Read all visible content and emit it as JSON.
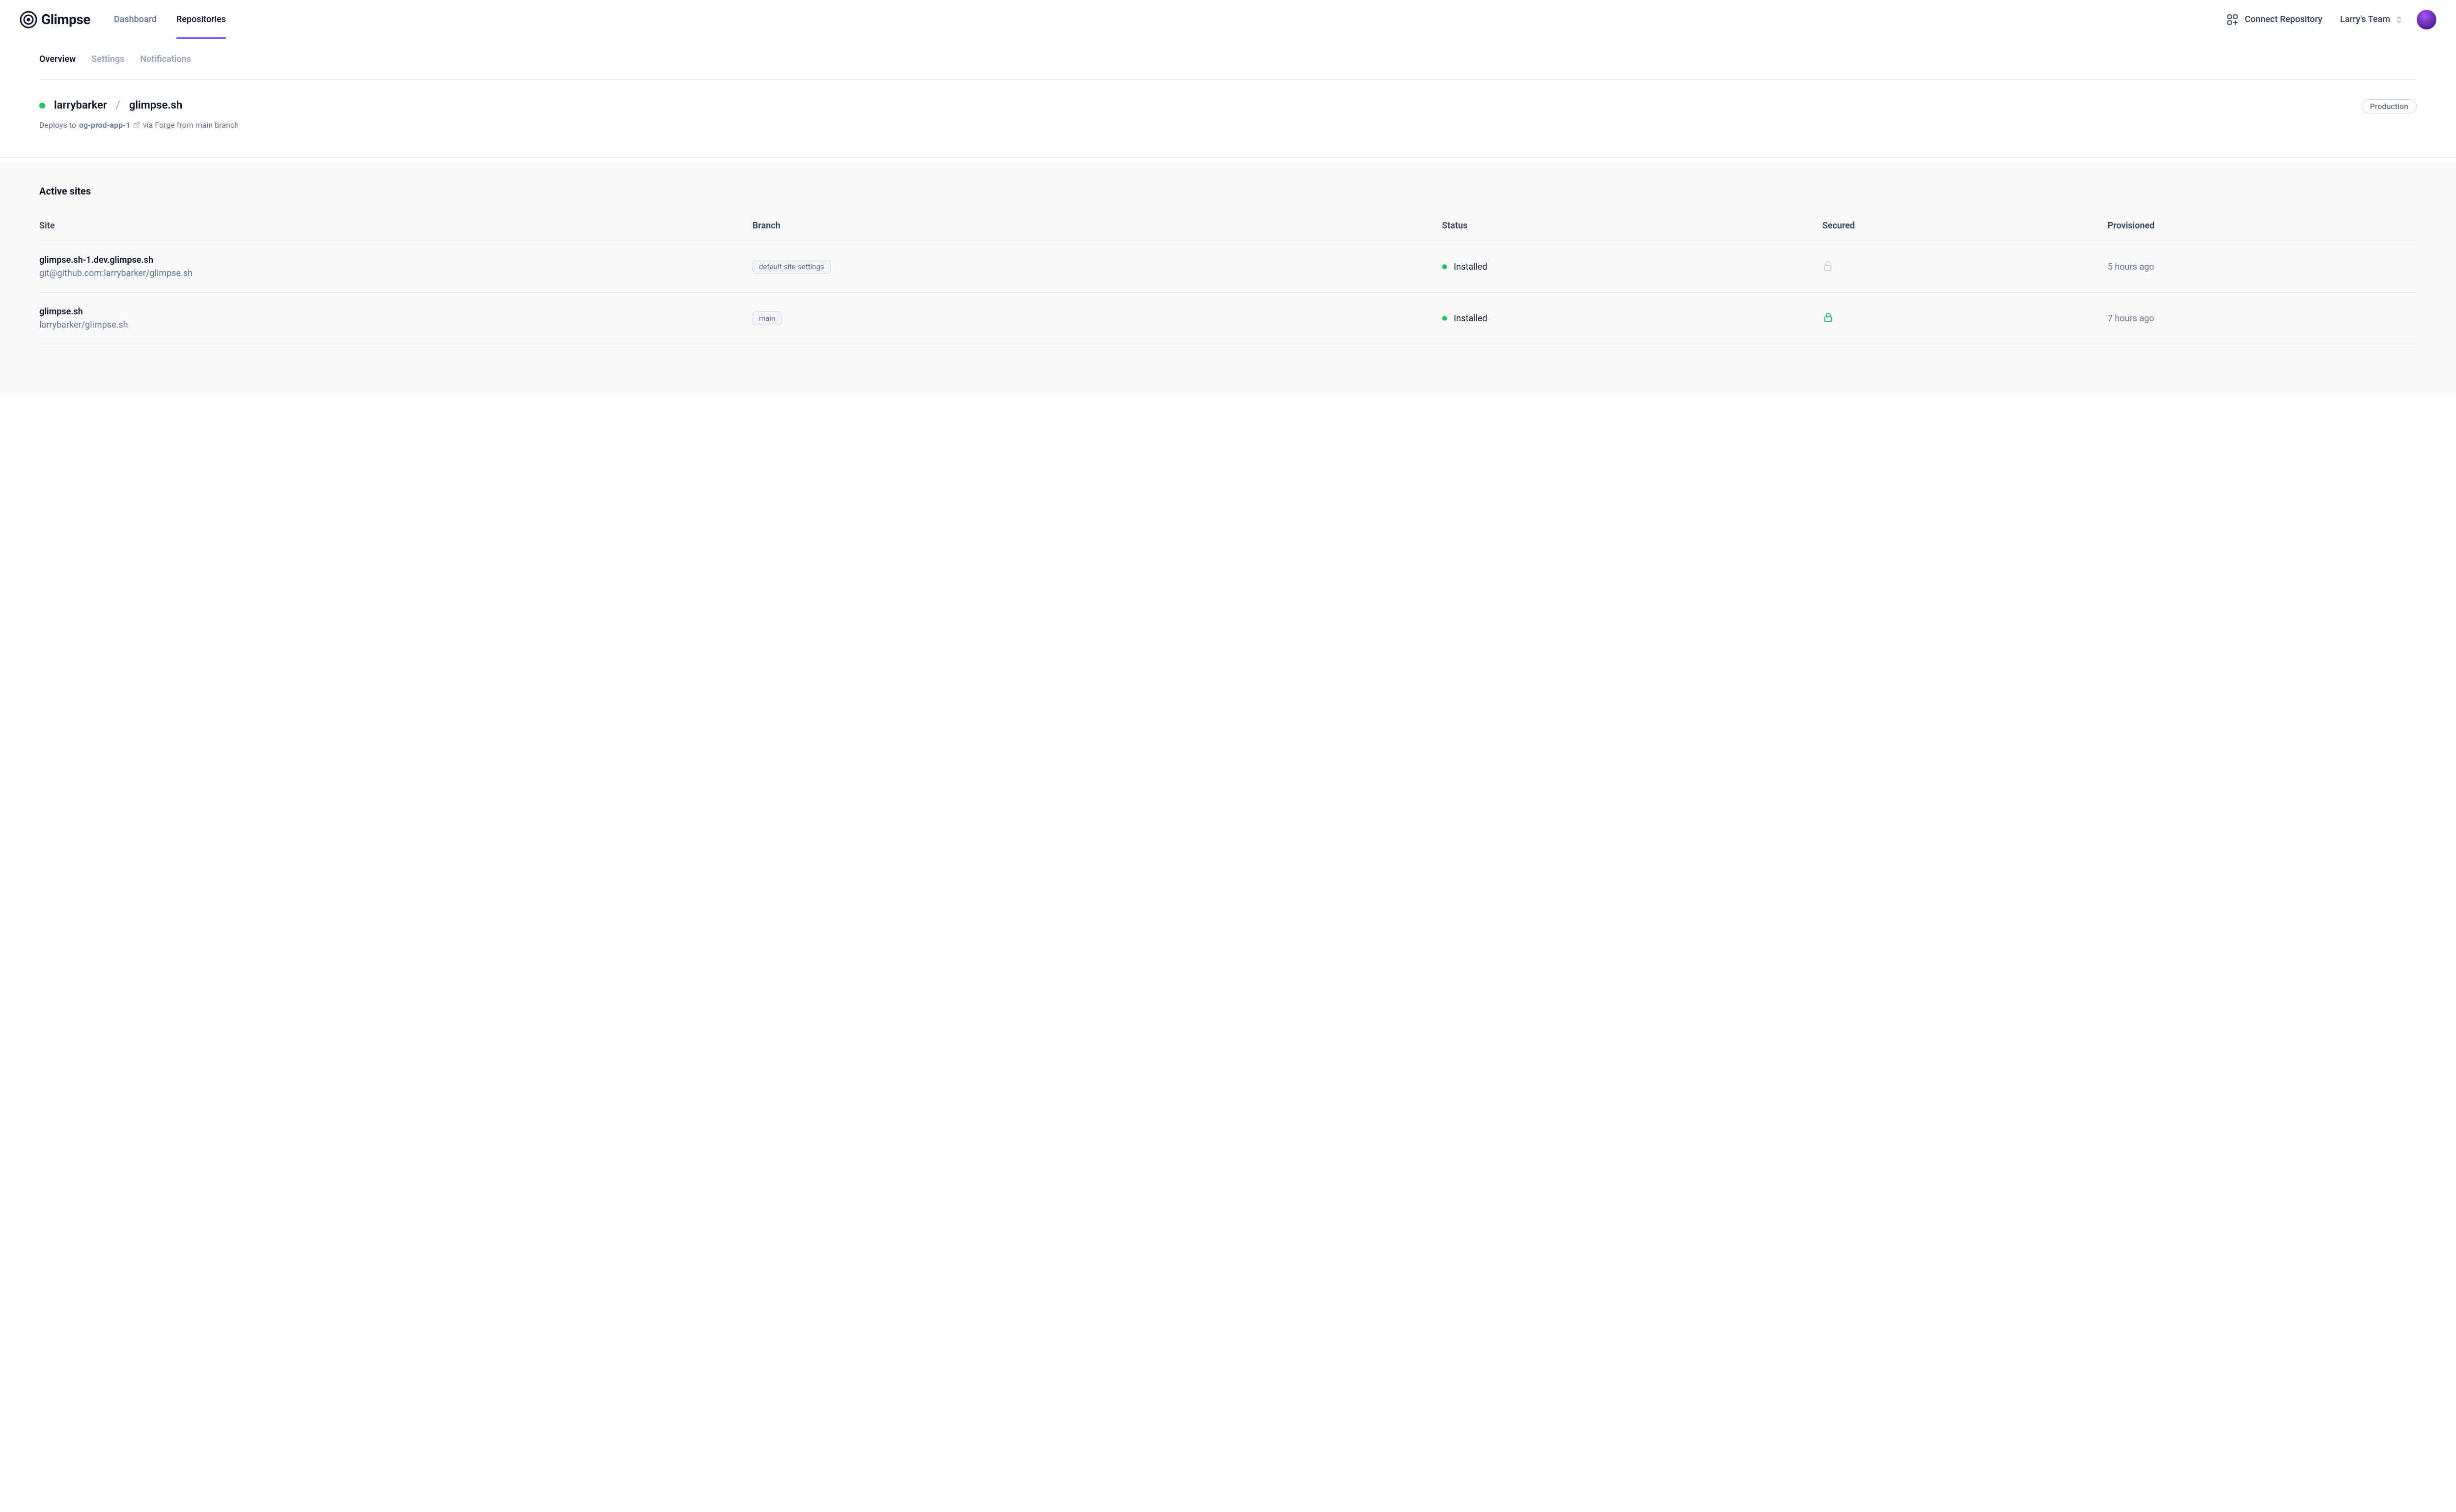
{
  "brand": {
    "name": "Glimpse"
  },
  "mainnav": {
    "dashboard": "Dashboard",
    "repositories": "Repositories"
  },
  "actions": {
    "connect_repository": "Connect Repository"
  },
  "team": {
    "name": "Larry's Team"
  },
  "subnav": {
    "overview": "Overview",
    "settings": "Settings",
    "notifications": "Notifications"
  },
  "repo": {
    "owner": "larrybarker",
    "separator": "/",
    "name": "glimpse.sh",
    "deploy_prefix": "Deploys to",
    "server": "og-prod-app-1",
    "deploy_suffix": "via Forge from main branch",
    "environment": "Production"
  },
  "sites_section": {
    "title": "Active sites",
    "columns": {
      "site": "Site",
      "branch": "Branch",
      "status": "Status",
      "secured": "Secured",
      "provisioned": "Provisioned"
    },
    "rows": [
      {
        "site": "glimpse.sh-1.dev.glimpse.sh",
        "repo": "git@github.com:larrybarker/glimpse.sh",
        "branch": "default-site-settings",
        "status": "Installed",
        "secured": false,
        "provisioned": "5 hours ago"
      },
      {
        "site": "glimpse.sh",
        "repo": "larrybarker/glimpse.sh",
        "branch": "main",
        "status": "Installed",
        "secured": true,
        "provisioned": "7 hours ago"
      }
    ]
  }
}
